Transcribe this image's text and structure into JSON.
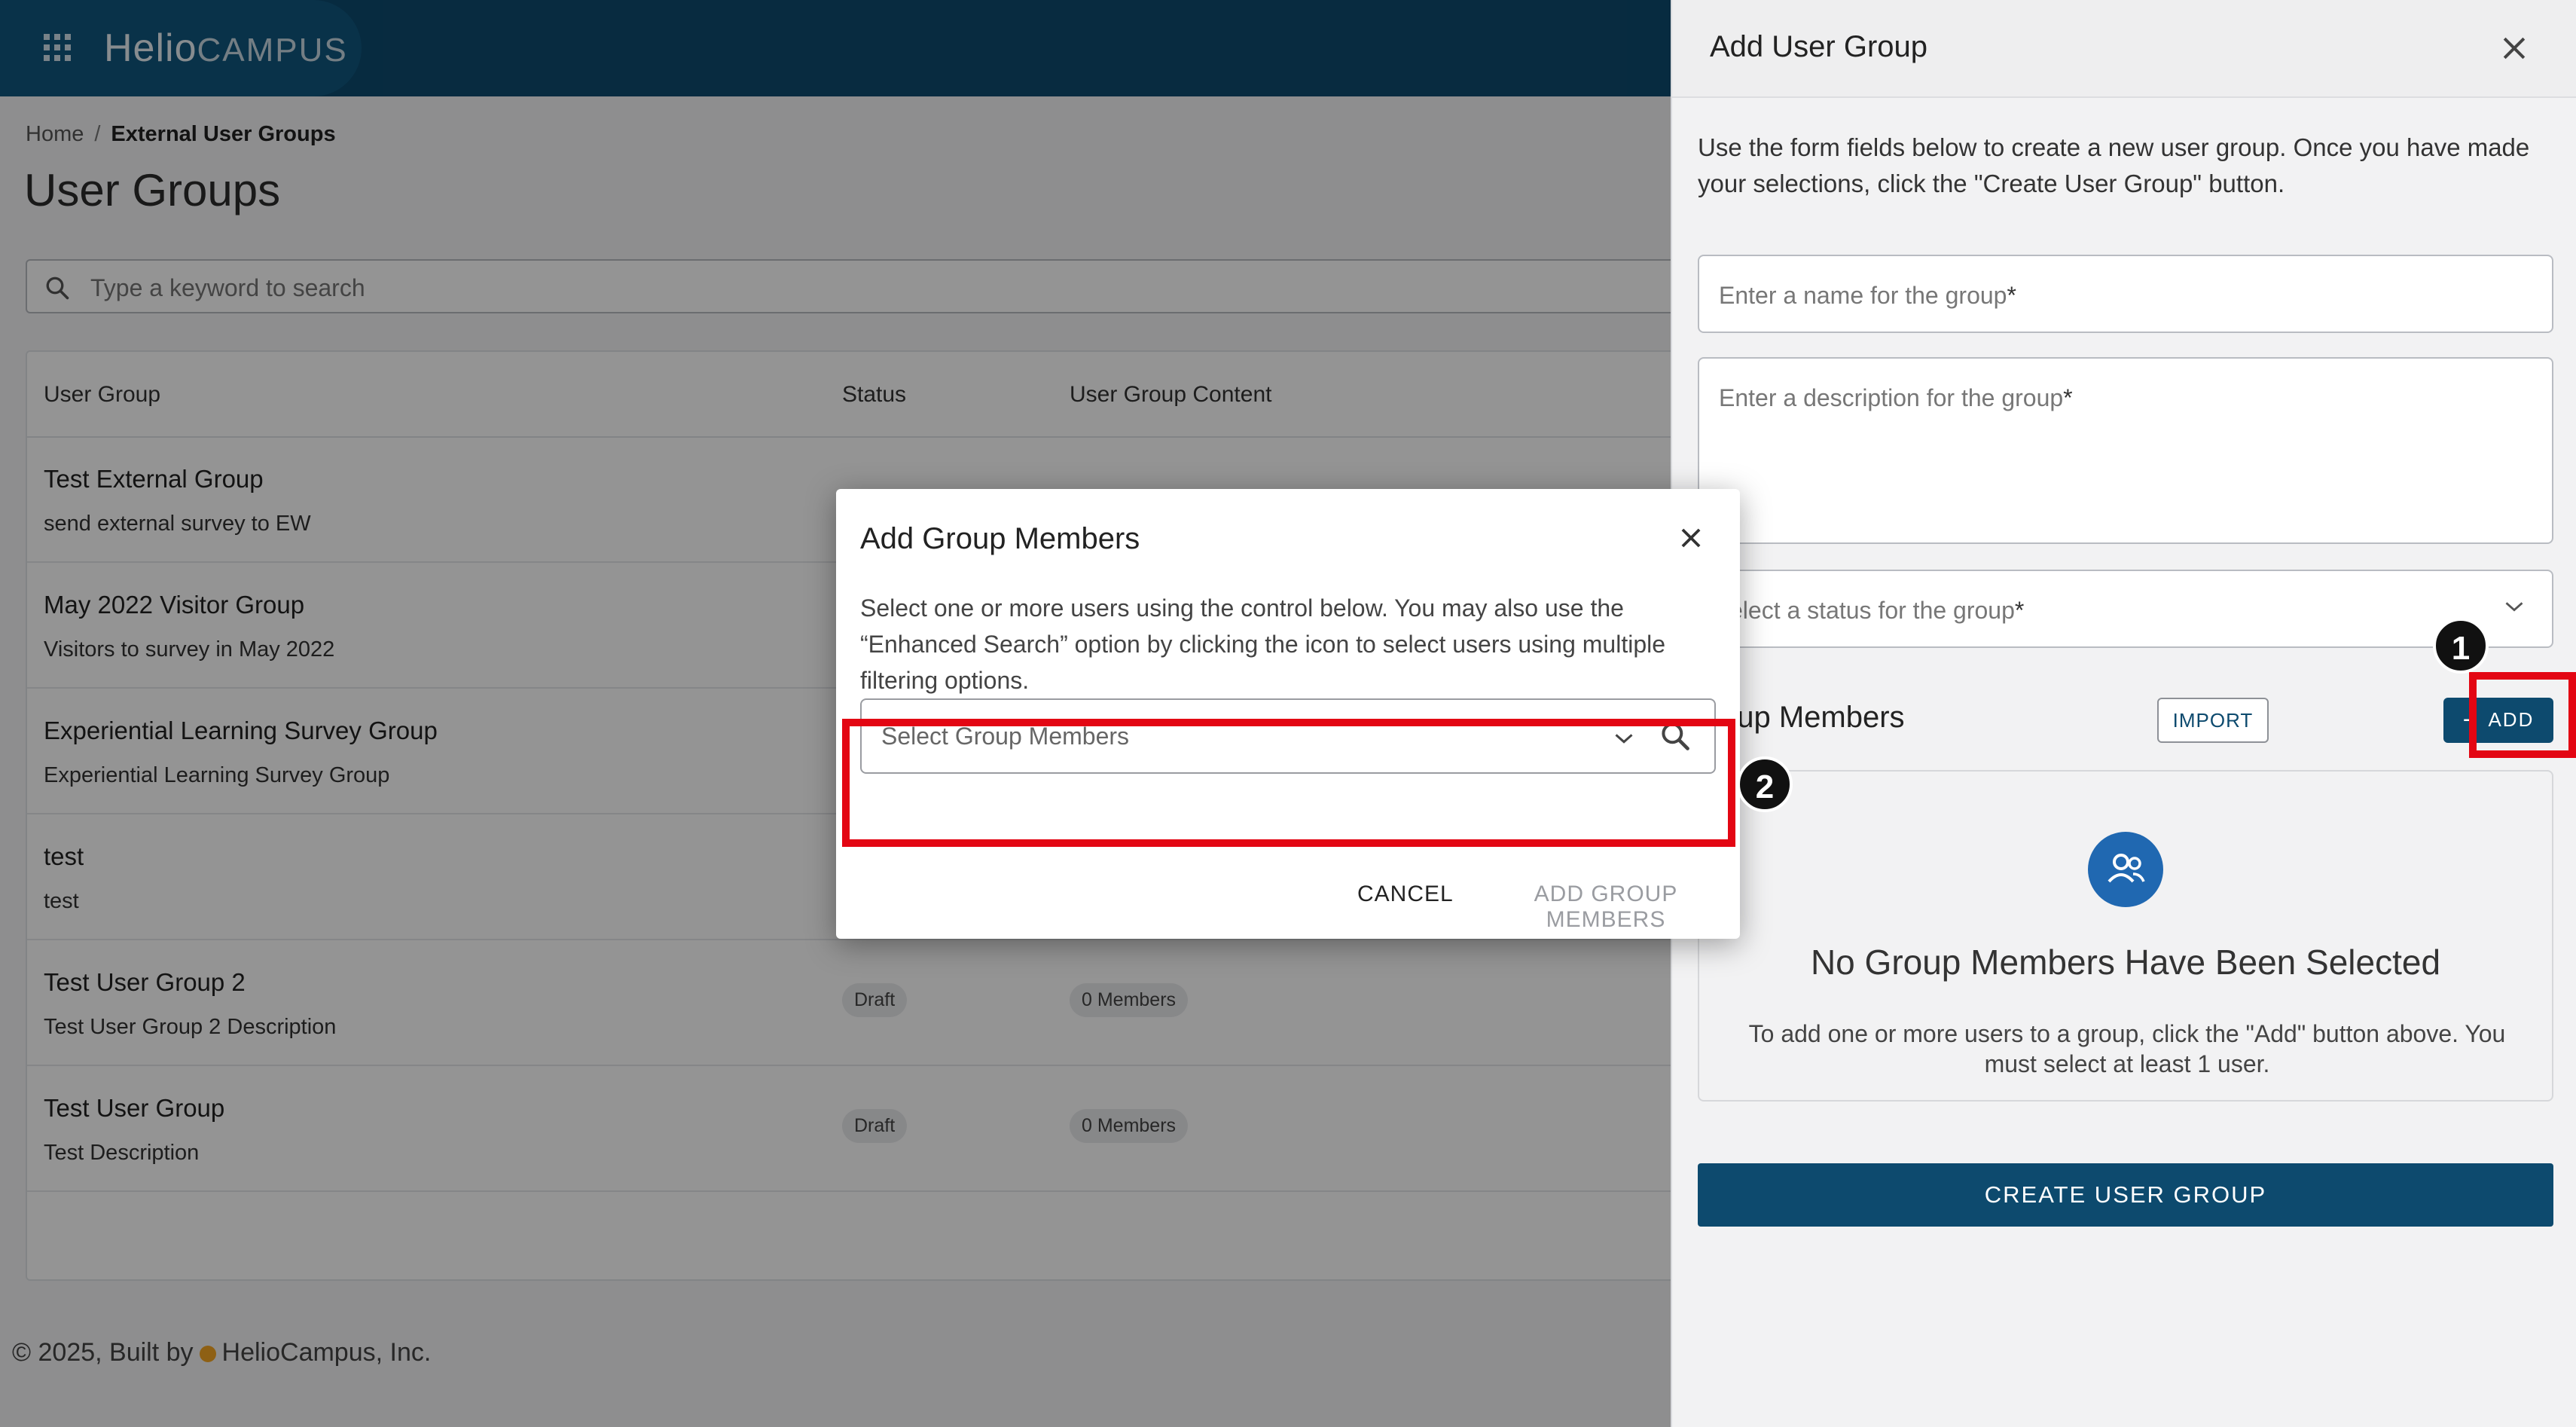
{
  "header": {
    "logo_primary": "Helio",
    "logo_secondary": "CAMPUS",
    "apps_icon": "grid-apps-icon"
  },
  "breadcrumb": {
    "home": "Home",
    "separator": "/",
    "current": "External User Groups"
  },
  "page_title": "User Groups",
  "search": {
    "placeholder": "Type a keyword to search",
    "icon": "search-icon"
  },
  "table": {
    "columns": [
      "User Group",
      "Status",
      "User Group Content"
    ],
    "rows": [
      {
        "name": "Test External Group",
        "description": "send external survey to EW",
        "status": "",
        "content": ""
      },
      {
        "name": "May 2022 Visitor Group",
        "description": "Visitors to survey in May 2022",
        "status": "",
        "content": ""
      },
      {
        "name": "Experiential Learning Survey Group",
        "description": "Experiential Learning Survey Group",
        "status": "",
        "content": ""
      },
      {
        "name": "test",
        "description": "test",
        "status": "",
        "content": ""
      },
      {
        "name": "Test User Group 2",
        "description": "Test User Group 2 Description",
        "status": "Draft",
        "content": "0 Members"
      },
      {
        "name": "Test User Group",
        "description": "Test Description",
        "status": "Draft",
        "content": "0 Members"
      }
    ]
  },
  "footer": {
    "prefix": "© 2025, Built by",
    "company": "HelioCampus, Inc."
  },
  "drawer": {
    "title": "Add User Group",
    "close_icon": "close-icon",
    "intro": "Use the form fields below to create a new user group. Once you have made your selections, click the \"Create User Group\" button.",
    "name_placeholder": "Enter a name for the group",
    "description_placeholder": "Enter a description for the group",
    "status_placeholder": "elect a status for the group",
    "required_mark": "*",
    "members_section_title": "oup Members",
    "import_label": "IMPORT",
    "add_label": "ADD",
    "empty_title": "No Group Members Have Been Selected",
    "empty_text": "To add one or more users to a group, click the \"Add\" button above. You must select at least 1 user.",
    "empty_icon": "group-users-icon",
    "create_label": "CREATE USER GROUP"
  },
  "modal": {
    "title": "Add Group Members",
    "close_icon": "close-icon",
    "body": "Select one or more users using the control below. You may also use the “Enhanced Search” option by clicking the icon to select users using multiple filtering options.",
    "select_placeholder": "Select Group Members",
    "cancel_label": "CANCEL",
    "add_members_label": "ADD GROUP MEMBERS"
  },
  "annotations": {
    "badge_1": "1",
    "badge_2": "2",
    "highlight_color": "#e30613"
  },
  "colors": {
    "brand": "#0d4a6e",
    "accent": "#2068b1"
  }
}
